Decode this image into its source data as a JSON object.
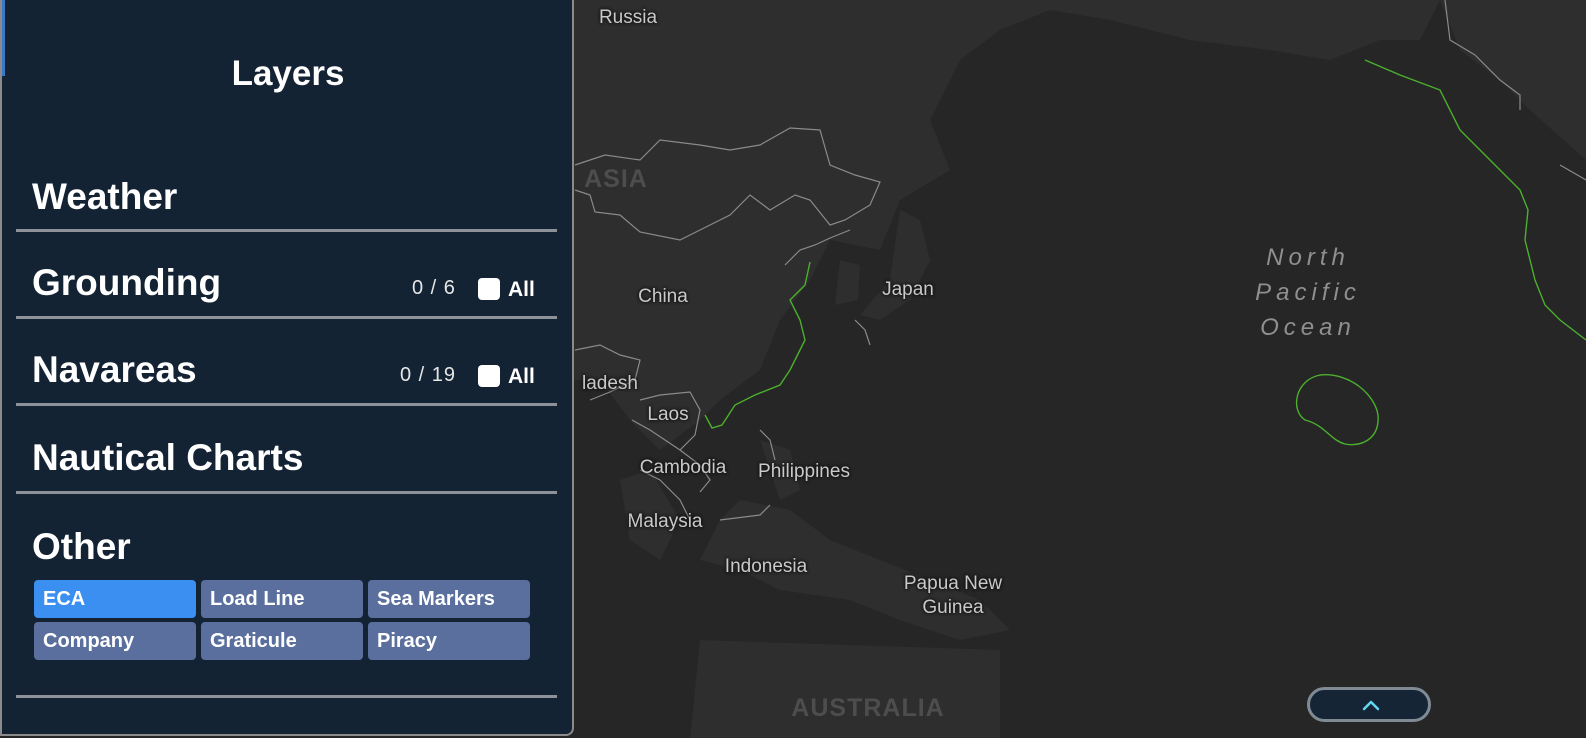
{
  "panel": {
    "title": "Layers",
    "sections": {
      "weather": {
        "title": "Weather"
      },
      "grounding": {
        "title": "Grounding",
        "count": "0 / 6",
        "all_label": "All",
        "all_checked": false
      },
      "navareas": {
        "title": "Navareas",
        "count": "0 / 19",
        "all_label": "All",
        "all_checked": false
      },
      "nautical_charts": {
        "title": "Nautical Charts"
      },
      "other": {
        "title": "Other",
        "chips": [
          {
            "label": "ECA",
            "active": true
          },
          {
            "label": "Load Line",
            "active": false
          },
          {
            "label": "Sea Markers",
            "active": false
          },
          {
            "label": "Company",
            "active": false
          },
          {
            "label": "Graticule",
            "active": false
          },
          {
            "label": "Piracy",
            "active": false
          }
        ]
      }
    }
  },
  "map": {
    "labels": {
      "russia": "Russia",
      "asia": "ASIA",
      "china": "China",
      "japan": "Japan",
      "bangladesh": "ladesh",
      "laos": "Laos",
      "cambodia": "Cambodia",
      "philippines": "Philippines",
      "malaysia": "Malaysia",
      "indonesia": "Indonesia",
      "papua_line1": "Papua New",
      "papua_line2": "Guinea",
      "australia": "AUSTRALIA",
      "ocean_line1": "North",
      "ocean_line2": "Pacific",
      "ocean_line3": "Ocean"
    }
  },
  "colors": {
    "map_background": "#262626",
    "land": "#2e2e2e",
    "border": "#8a8a8a",
    "eca_line": "#4caf2e",
    "panel_background": "#132334",
    "chip_default": "#5a6f9d",
    "chip_active": "#3a8ff0"
  },
  "icons": {
    "expand": "chevron-up-icon"
  }
}
